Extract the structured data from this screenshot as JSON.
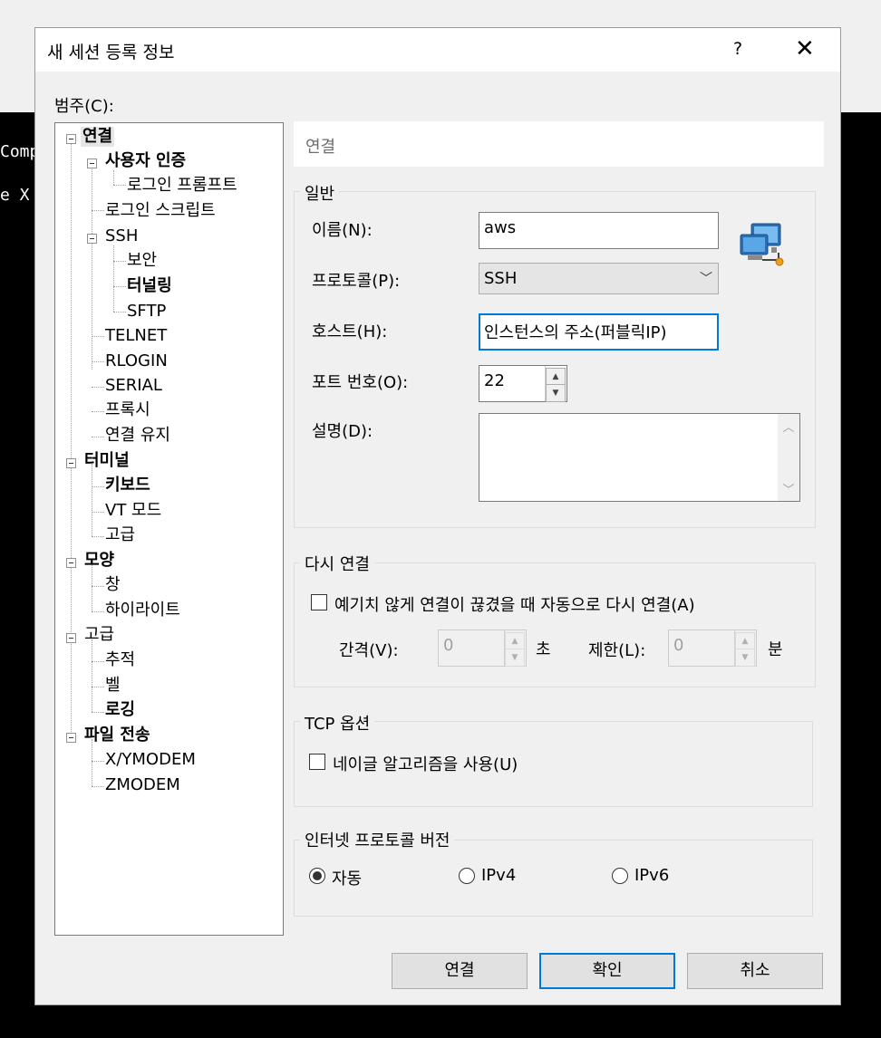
{
  "background": {
    "terminal_lines": [
      "Comp",
      "e X"
    ]
  },
  "dialog": {
    "title": "새 세션 등록 정보",
    "help": "?",
    "close": "✕",
    "category_label": "범주(C):"
  },
  "tree": {
    "connection": "연결",
    "user_auth": "사용자 인증",
    "login_prompt": "로그인 프롬프트",
    "login_script": "로그인 스크립트",
    "ssh": "SSH",
    "security": "보안",
    "tunneling": "터널링",
    "sftp": "SFTP",
    "telnet": "TELNET",
    "rlogin": "RLOGIN",
    "serial": "SERIAL",
    "proxy": "프록시",
    "keepalive": "연결 유지",
    "terminal": "터미널",
    "keyboard": "키보드",
    "vt_mode": "VT 모드",
    "advanced": "고급",
    "appearance": "모양",
    "window": "창",
    "highlight": "하이라이트",
    "advanced2": "고급",
    "trace": "추적",
    "bell": "벨",
    "logging": "로깅",
    "file_transfer": "파일 전송",
    "xymodem": "X/YMODEM",
    "zmodem": "ZMODEM"
  },
  "panel": {
    "header": "연결",
    "general": {
      "legend": "일반",
      "name_label": "이름(N):",
      "name_value": "aws",
      "protocol_label": "프로토콜(P):",
      "protocol_value": "SSH",
      "host_label": "호스트(H):",
      "host_value": "인스턴스의 주소(퍼블릭IP)",
      "port_label": "포트 번호(O):",
      "port_value": "22",
      "desc_label": "설명(D):",
      "desc_value": ""
    },
    "reconnect": {
      "legend": "다시 연결",
      "checkbox_label": "예기치 않게 연결이 끊겼을 때 자동으로 다시 연결(A)",
      "checked": false,
      "interval_label": "간격(V):",
      "interval_value": "0",
      "interval_unit": "초",
      "limit_label": "제한(L):",
      "limit_value": "0",
      "limit_unit": "분"
    },
    "tcp": {
      "legend": "TCP 옵션",
      "nagle_label": "네이글 알고리즘을 사용(U)",
      "checked": false
    },
    "ip": {
      "legend": "인터넷 프로토콜 버전",
      "auto": "자동",
      "ipv4": "IPv4",
      "ipv6": "IPv6",
      "selected": "auto"
    }
  },
  "buttons": {
    "connect": "연결",
    "ok": "확인",
    "cancel": "취소"
  },
  "colors": {
    "focus": "#0078d7",
    "dialog_bg": "#f0f0f0"
  }
}
